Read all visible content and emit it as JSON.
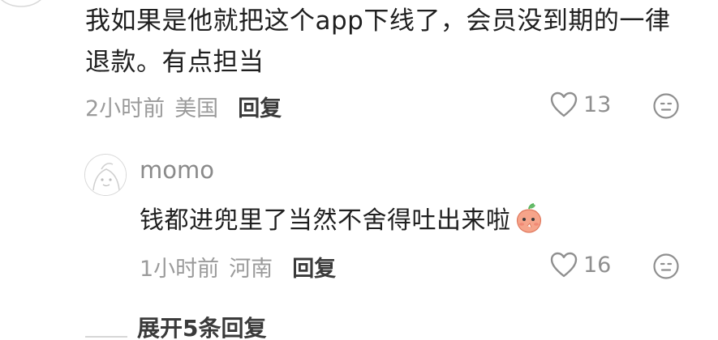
{
  "comment": {
    "text": "我如果是他就把这个app下线了，会员没到期的一律退款。有点担当",
    "time": "2小时前",
    "location": "美国",
    "reply_label": "回复",
    "like_count": "13",
    "like_icon": "heart-outline",
    "emoji_icon": "smiley-face"
  },
  "reply": {
    "username": "momo",
    "text": "钱都进兜里了当然不舍得吐出来啦",
    "emoji": "peach-blush-sticker",
    "time": "1小时前",
    "location": "河南",
    "reply_label": "回复",
    "like_count": "16",
    "like_icon": "heart-outline",
    "emoji_icon": "smiley-face"
  },
  "expand": {
    "label": "展开5条回复"
  },
  "colors": {
    "text_primary": "#1f1f1f",
    "text_meta": "#9b9b9b",
    "reply_button": "#3a3a3a",
    "peach": "#f6a48a"
  }
}
